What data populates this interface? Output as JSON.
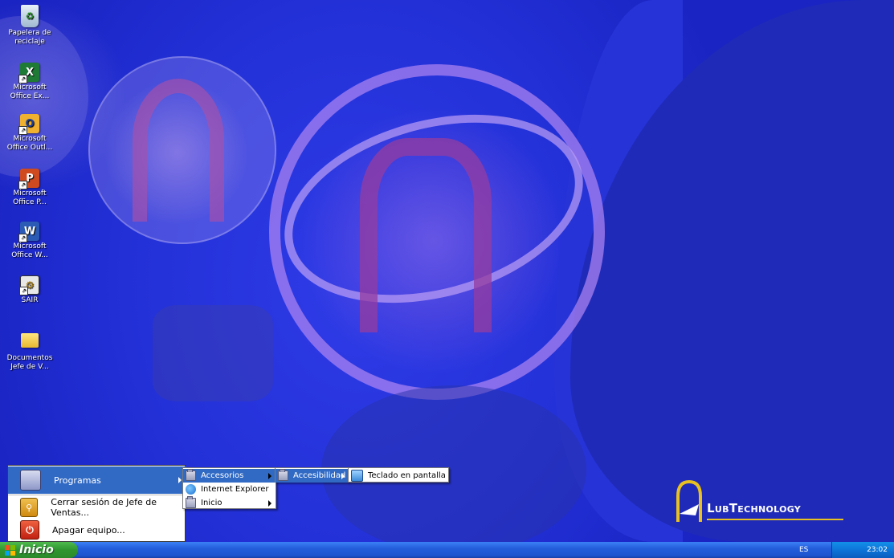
{
  "desktop_icons": [
    {
      "label": "Papelera de reciclaje",
      "icon": "recycle-bin-icon"
    },
    {
      "label": "Microsoft Office Ex...",
      "icon": "excel-icon"
    },
    {
      "label": "Microsoft Office Outl...",
      "icon": "outlook-icon"
    },
    {
      "label": "Microsoft Office P...",
      "icon": "powerpoint-icon"
    },
    {
      "label": "Microsoft Office W...",
      "icon": "word-icon"
    },
    {
      "label": "SAIR",
      "icon": "sair-app-icon"
    },
    {
      "label": "Documentos Jefe de V...",
      "icon": "folder-icon"
    }
  ],
  "start_menu": {
    "programas": "Programas",
    "cerrar_sesion": "Cerrar sesión de Jefe de Ventas...",
    "apagar": "Apagar equipo..."
  },
  "programs_menu": {
    "items": [
      "Accesorios",
      "Internet Explorer",
      "Inicio"
    ]
  },
  "accesorios_menu": {
    "items": [
      "Accesibilidad"
    ]
  },
  "accesibilidad_menu": {
    "items": [
      "Teclado en pantalla"
    ]
  },
  "taskbar": {
    "start_label": "Inicio",
    "language": "ES",
    "clock": "23:02"
  },
  "logo": {
    "text": "LubTechnology"
  },
  "colors": {
    "selection": "#316ac5",
    "taskbar": "#245edb",
    "start_button": "#2f962f",
    "tray": "#0c6fd4",
    "logo_accent": "#e8c020"
  }
}
